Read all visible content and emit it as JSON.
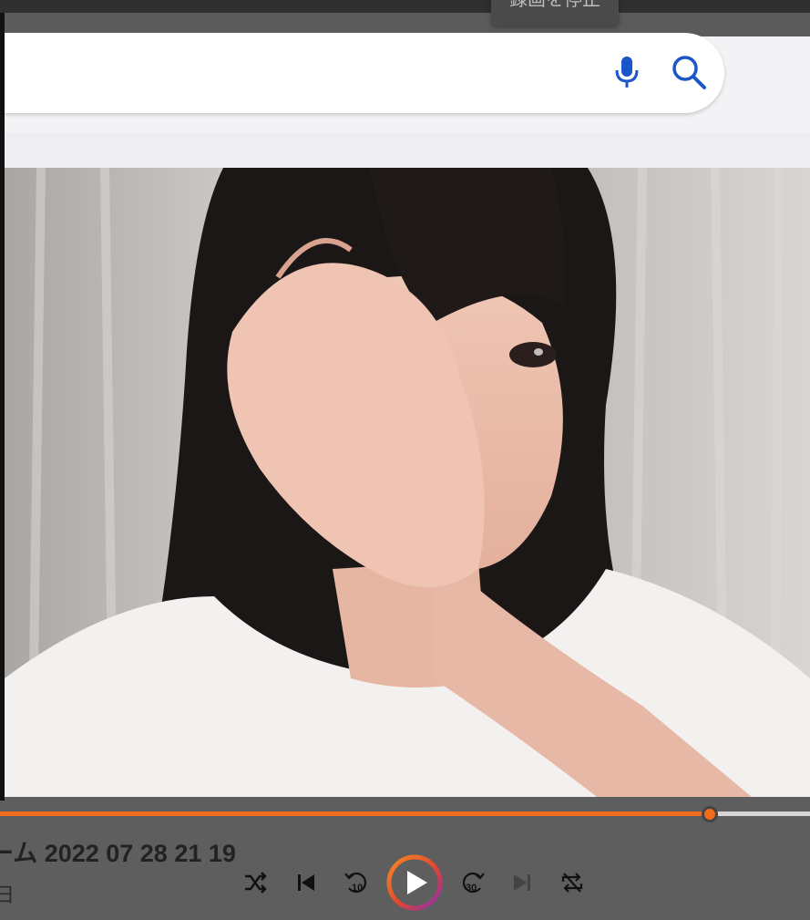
{
  "overlay": {
    "stop_recording_label": "録画を停止"
  },
  "search": {
    "voice_label": "voice-search",
    "search_label": "search"
  },
  "player": {
    "title": "ーム 2022 07 28 21 19",
    "date": "日",
    "progress": 0.876,
    "rewind_seconds": "10",
    "forward_seconds": "30",
    "accent_color": "#f26a1b"
  }
}
